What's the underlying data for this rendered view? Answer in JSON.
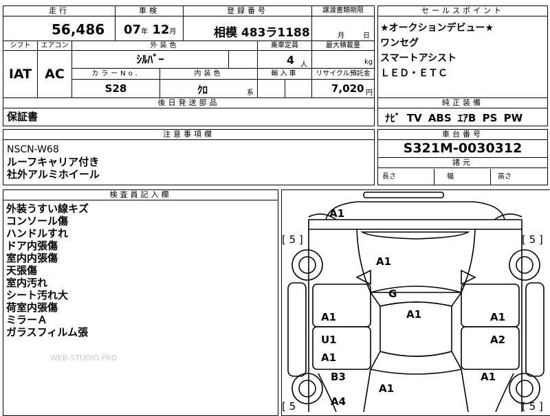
{
  "top": {
    "headers": {
      "mileage": "走行",
      "inspection": "車検",
      "registration": "登録番号",
      "transfer": "譲渡書類期限",
      "sales": "セールスポイント"
    },
    "mileage_value": "56,486",
    "mileage_unit": "km",
    "inspection_year": "07",
    "inspection_year_unit": "年",
    "inspection_month": "12",
    "inspection_month_unit": "月",
    "registration_value": "相模 483ラ1188",
    "transfer_month_unit": "月",
    "transfer_day_unit": "日"
  },
  "row2": {
    "headers": {
      "shift": "シフト",
      "aircon": "エアコン",
      "exterior_color": "外装色",
      "capacity": "乗車定員",
      "max_load": "最大積載量"
    },
    "shift": "IAT",
    "aircon": "AC",
    "exterior_color": "ｼﾙﾊﾞｰ",
    "capacity": "4",
    "capacity_unit": "人",
    "max_load_unit": "kg"
  },
  "row3": {
    "headers": {
      "color_no": "カラーNo.",
      "interior_color": "内装色",
      "import": "輸入車",
      "recycle": "リサイクル預託金"
    },
    "color_no": "S28",
    "interior_color": "ｸﾛ",
    "interior_suffix": "系",
    "recycle": "7,020",
    "recycle_unit": "円"
  },
  "sales_points": [
    "★オークションデビュー★",
    "ワンセグ",
    "スマートアシスト",
    "ＬＥＤ・ＥＴＣ"
  ],
  "later_parts": {
    "header": "後日発送部品",
    "value": "保証書"
  },
  "equipment": {
    "header": "純正装備",
    "items": [
      "ﾅﾋﾞ",
      "TV",
      "ABS",
      "ｴｱB",
      "PS",
      "PW"
    ]
  },
  "notes": {
    "header": "注意事項欄",
    "lines": [
      "NSCN-W68",
      "ルーフキャリア付き",
      "社外アルミホイール"
    ]
  },
  "chassis": {
    "header": "車台番号",
    "value": "S321M-0030312"
  },
  "specs": {
    "header": "諸元",
    "length": "長さ",
    "width": "幅",
    "height": "高さ"
  },
  "inspector": {
    "header": "検査員記入欄",
    "lines": [
      "外装うすい線キズ",
      "コンソール傷",
      "ハンドルすれ",
      "ドア内張傷",
      "室内内張傷",
      "天張傷",
      "室内汚れ",
      "シート汚れ大",
      "荷室内張傷",
      "ミラーＡ",
      "ガラスフィルム張"
    ]
  },
  "watermark": "WEB-STUDIO.PRO",
  "diagram": {
    "marks": {
      "front_left": "A1",
      "hood": "A1",
      "roof_g": "G",
      "roof": "A1",
      "door_fl": "A1",
      "door_fr": "A1",
      "door_rl_u": "U1",
      "door_rl": "A1",
      "door_rr": "A2",
      "quarter_l": "B3",
      "quarter_r": "A1",
      "rear": "A1",
      "rear_l": "A4"
    },
    "tires": {
      "fl": "[ 5 ]",
      "fr": "[ 5 ]",
      "rl": "[ 5",
      "rr": "[ 5 ]"
    }
  }
}
